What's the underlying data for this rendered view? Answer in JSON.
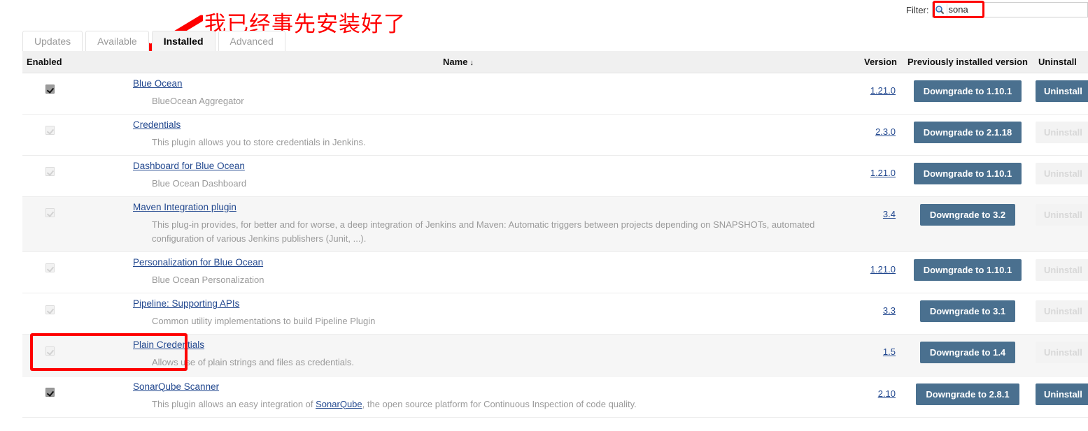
{
  "filter": {
    "label": "Filter:",
    "value": "sona",
    "placeholder": "",
    "icon": "search-icon"
  },
  "annotations": {
    "note_text": "我已经事先安装好了",
    "note_color": "#fe0000",
    "highlight_color": "#fe0000"
  },
  "tabs": [
    {
      "label": "Updates",
      "active": false
    },
    {
      "label": "Available",
      "active": false
    },
    {
      "label": "Installed",
      "active": true
    },
    {
      "label": "Advanced",
      "active": false
    }
  ],
  "table": {
    "headers": {
      "enabled": "Enabled",
      "name": "Name",
      "name_sort_arrow": "↓",
      "version": "Version",
      "previously_installed": "Previously installed version",
      "uninstall": "Uninstall"
    },
    "button_color": "#4a708f",
    "rows": [
      {
        "enabled": true,
        "checkbox_state": "checked-active",
        "name": "Blue Ocean",
        "description": "BlueOcean Aggregator",
        "description_link": "",
        "description_tail": "",
        "version": "1.21.0",
        "downgrade_label": "Downgrade to 1.10.1",
        "uninstall_label": "Uninstall",
        "uninstall_enabled": true,
        "shaded": false
      },
      {
        "enabled": true,
        "checkbox_state": "checked-disabled",
        "name": "Credentials",
        "description": "This plugin allows you to store credentials in Jenkins.",
        "description_link": "",
        "description_tail": "",
        "version": "2.3.0",
        "downgrade_label": "Downgrade to 2.1.18",
        "uninstall_label": "Uninstall",
        "uninstall_enabled": false,
        "shaded": false
      },
      {
        "enabled": true,
        "checkbox_state": "checked-disabled",
        "name": "Dashboard for Blue Ocean",
        "description": "Blue Ocean Dashboard",
        "description_link": "",
        "description_tail": "",
        "version": "1.21.0",
        "downgrade_label": "Downgrade to 1.10.1",
        "uninstall_label": "Uninstall",
        "uninstall_enabled": false,
        "shaded": false
      },
      {
        "enabled": true,
        "checkbox_state": "checked-disabled",
        "name": "Maven Integration plugin",
        "description": "This plug-in provides, for better and for worse, a deep integration of Jenkins and Maven: Automatic triggers between projects depending on SNAPSHOTs, automated configuration of various Jenkins publishers (Junit, ...).",
        "description_link": "",
        "description_tail": "",
        "version": "3.4",
        "downgrade_label": "Downgrade to 3.2",
        "uninstall_label": "Uninstall",
        "uninstall_enabled": false,
        "shaded": true
      },
      {
        "enabled": true,
        "checkbox_state": "checked-disabled",
        "name": "Personalization for Blue Ocean",
        "description": "Blue Ocean Personalization",
        "description_link": "",
        "description_tail": "",
        "version": "1.21.0",
        "downgrade_label": "Downgrade to 1.10.1",
        "uninstall_label": "Uninstall",
        "uninstall_enabled": false,
        "shaded": false
      },
      {
        "enabled": true,
        "checkbox_state": "checked-disabled",
        "name": "Pipeline: Supporting APIs",
        "description": "Common utility implementations to build Pipeline Plugin",
        "description_link": "",
        "description_tail": "",
        "version": "3.3",
        "downgrade_label": "Downgrade to 3.1",
        "uninstall_label": "Uninstall",
        "uninstall_enabled": false,
        "shaded": false
      },
      {
        "enabled": true,
        "checkbox_state": "checked-disabled",
        "name": "Plain Credentials",
        "description": "Allows use of plain strings and files as credentials.",
        "description_link": "",
        "description_tail": "",
        "version": "1.5",
        "downgrade_label": "Downgrade to 1.4",
        "uninstall_label": "Uninstall",
        "uninstall_enabled": false,
        "shaded": true
      },
      {
        "enabled": true,
        "checkbox_state": "checked-active",
        "name": "SonarQube Scanner",
        "description": "This plugin allows an easy integration of ",
        "description_link": "SonarQube",
        "description_tail": ", the open source platform for Continuous Inspection of code quality.",
        "version": "2.10",
        "downgrade_label": "Downgrade to 2.8.1",
        "uninstall_label": "Uninstall",
        "uninstall_enabled": true,
        "shaded": false
      }
    ]
  }
}
